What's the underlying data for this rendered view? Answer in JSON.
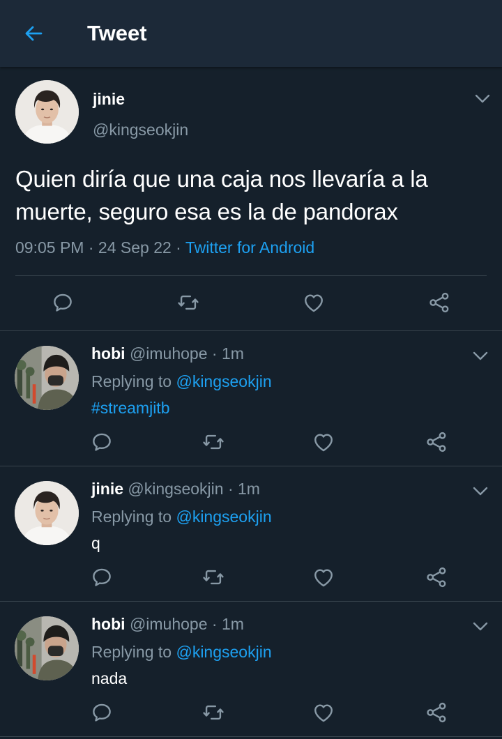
{
  "header": {
    "title": "Tweet",
    "back_icon": "arrow-left-icon",
    "accent": "#1da1f2"
  },
  "tweet": {
    "name": "jinie",
    "handle": "@kingseokjin",
    "text": "Quien diría que una caja nos llevaría a la muerte, seguro esa es la de pandorax",
    "time": "09:05 PM",
    "date": "24 Sep 22",
    "separator": "·",
    "source": "Twitter for Android"
  },
  "actions": [
    "reply-icon",
    "retweet-icon",
    "like-icon",
    "share-icon"
  ],
  "replies": [
    {
      "name": "hobi",
      "handle": "@imuhope",
      "time": "1m",
      "replying_to_label": "Replying to",
      "replying_to": "@kingseokjin",
      "text": "#streamjitb"
    },
    {
      "name": "jinie",
      "handle": "@kingseokjin",
      "time": "1m",
      "replying_to_label": "Replying to",
      "replying_to": "@kingseokjin",
      "text": "q"
    },
    {
      "name": "hobi",
      "handle": "@imuhope",
      "time": "1m",
      "replying_to_label": "Replying to",
      "replying_to": "@kingseokjin",
      "text": "nada"
    }
  ],
  "colors": {
    "background": "#15202b",
    "header_bg": "#1c2938",
    "secondary_text": "#8899a6",
    "divider": "#38444d"
  }
}
